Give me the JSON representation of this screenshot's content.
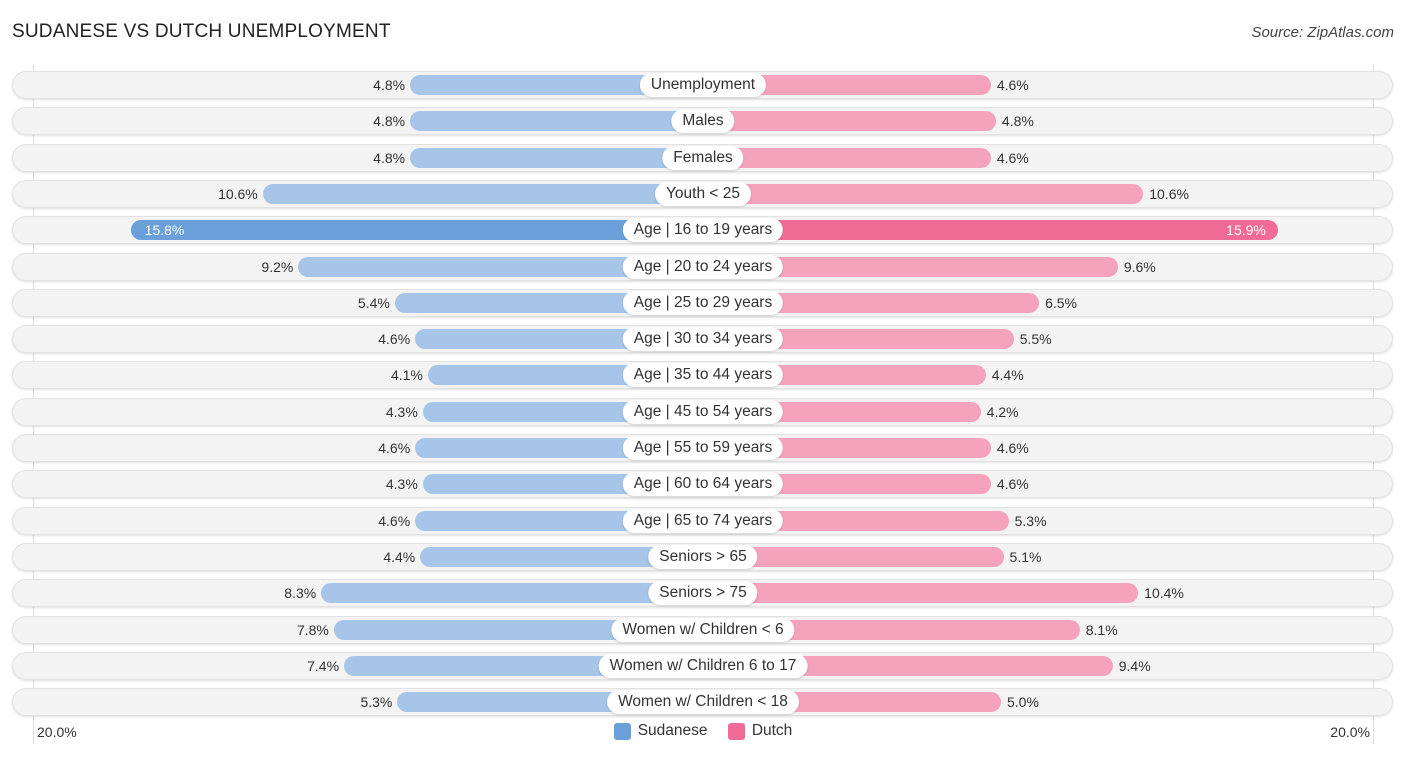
{
  "chart_data": {
    "type": "bar",
    "orientation": "horizontal-diverging",
    "title": "SUDANESE VS DUTCH UNEMPLOYMENT",
    "source": "Source: ZipAtlas.com",
    "categories": [
      "Unemployment",
      "Males",
      "Females",
      "Youth < 25",
      "Age | 16 to 19 years",
      "Age | 20 to 24 years",
      "Age | 25 to 29 years",
      "Age | 30 to 34 years",
      "Age | 35 to 44 years",
      "Age | 45 to 54 years",
      "Age | 55 to 59 years",
      "Age | 60 to 64 years",
      "Age | 65 to 74 years",
      "Seniors > 65",
      "Seniors > 75",
      "Women w/ Children < 6",
      "Women w/ Children 6 to 17",
      "Women w/ Children < 18"
    ],
    "series": [
      {
        "name": "Sudanese",
        "color": "#6a9fd9",
        "values": [
          4.8,
          4.8,
          4.8,
          10.6,
          15.8,
          9.2,
          5.4,
          4.6,
          4.1,
          4.3,
          4.6,
          4.3,
          4.6,
          4.4,
          8.3,
          7.8,
          7.4,
          5.3
        ]
      },
      {
        "name": "Dutch",
        "color": "#f06b96",
        "values": [
          4.6,
          4.8,
          4.6,
          10.6,
          15.9,
          9.6,
          6.5,
          5.5,
          4.4,
          4.2,
          4.6,
          4.6,
          5.3,
          5.1,
          10.4,
          8.1,
          9.4,
          5.0
        ]
      }
    ],
    "value_labels_left": [
      "4.8%",
      "4.8%",
      "4.8%",
      "10.6%",
      "15.8%",
      "9.2%",
      "5.4%",
      "4.6%",
      "4.1%",
      "4.3%",
      "4.6%",
      "4.3%",
      "4.6%",
      "4.4%",
      "8.3%",
      "7.8%",
      "7.4%",
      "5.3%"
    ],
    "value_labels_right": [
      "4.6%",
      "4.8%",
      "4.6%",
      "10.6%",
      "15.9%",
      "9.6%",
      "6.5%",
      "5.5%",
      "4.4%",
      "4.2%",
      "4.6%",
      "4.6%",
      "5.3%",
      "5.1%",
      "10.4%",
      "8.1%",
      "9.4%",
      "5.0%"
    ],
    "axis_min_label": "20.0%",
    "axis_max_label": "20.0%",
    "xlim": [
      -20,
      20
    ],
    "highlight_index": 4,
    "legend": [
      "Sudanese",
      "Dutch"
    ],
    "legend_position": "bottom-center",
    "grid": false
  }
}
